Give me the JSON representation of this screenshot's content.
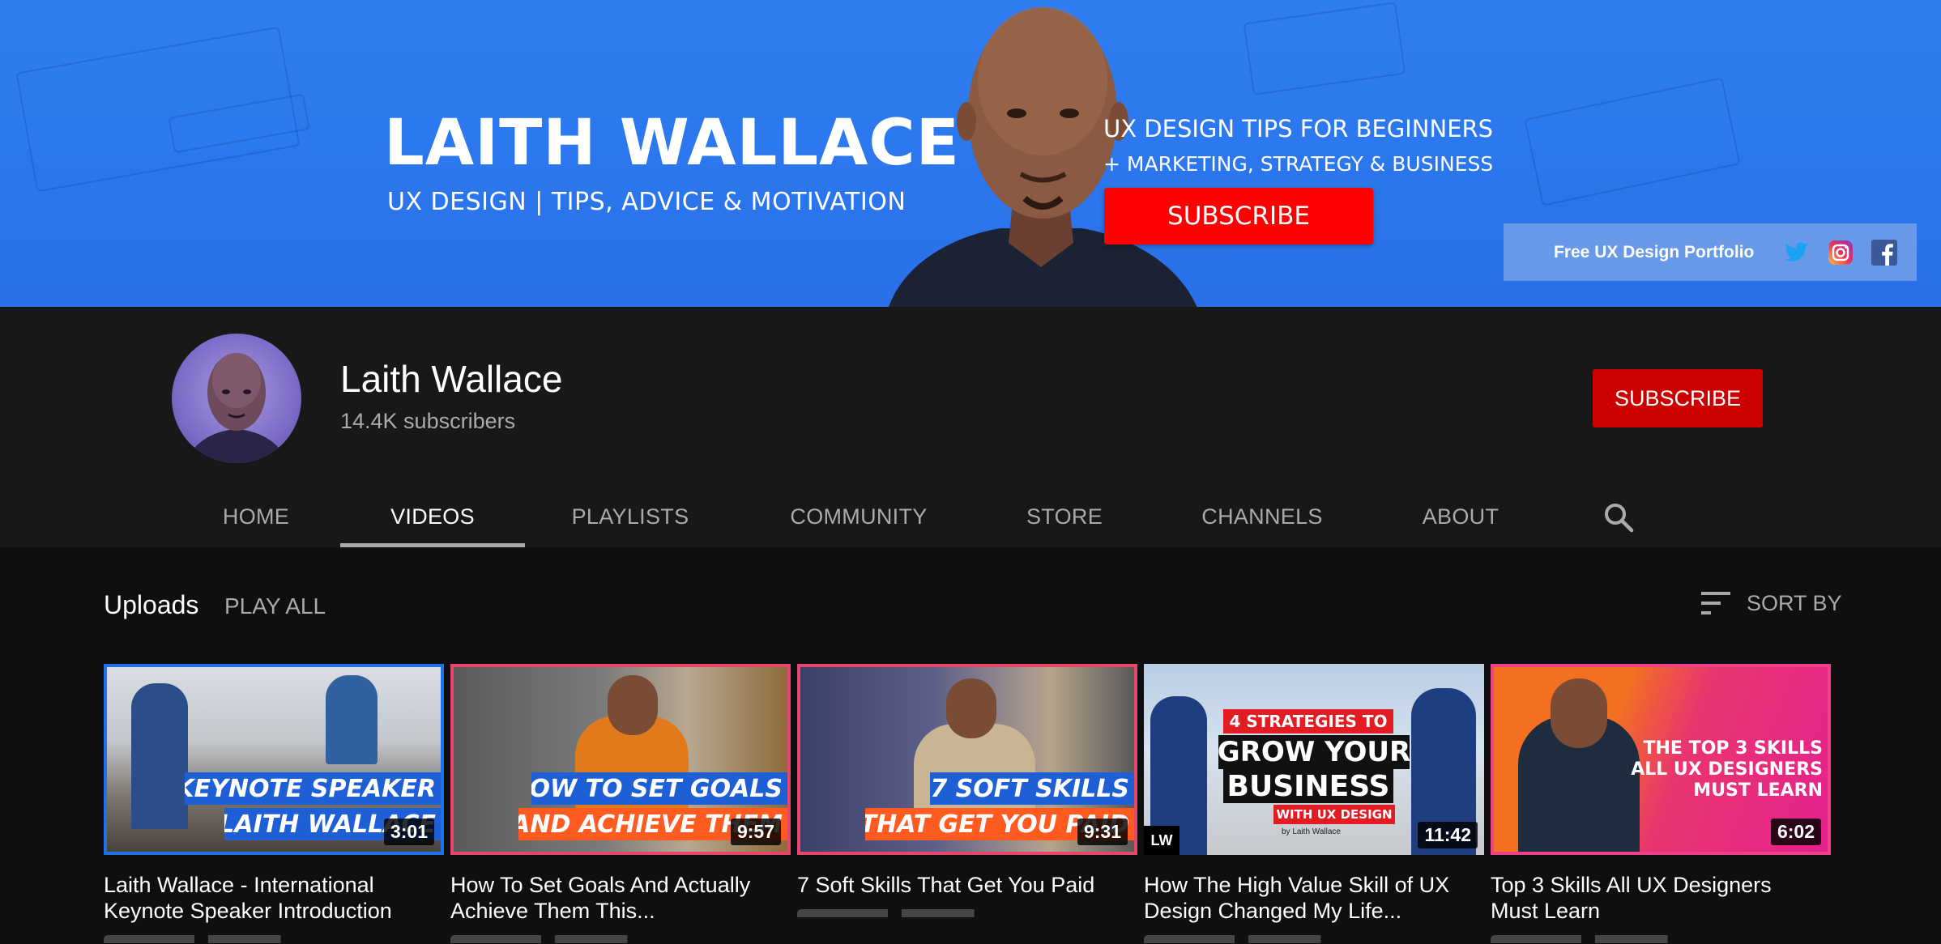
{
  "banner": {
    "title": "LAITH WALLACE",
    "subtitle": "UX DESIGN | TIPS, ADVICE & MOTIVATION",
    "tip_line1": "UX DESIGN  TIPS FOR BEGINNERS",
    "tip_line2": "+ MARKETING, STRATEGY & BUSINESS",
    "subscribe_label": "SUBSCRIBE",
    "link_text": "Free UX Design Portfolio",
    "social_icons": [
      "twitter-icon",
      "instagram-icon",
      "facebook-icon"
    ],
    "colors": {
      "background": "#2c78ee",
      "subscribe": "#ff0000"
    }
  },
  "channel": {
    "name": "Laith Wallace",
    "subscribers": "14.4K subscribers",
    "subscribe_label": "SUBSCRIBE",
    "subscribe_color": "#cc0000"
  },
  "tabs": [
    {
      "label": "HOME",
      "active": false
    },
    {
      "label": "VIDEOS",
      "active": true
    },
    {
      "label": "PLAYLISTS",
      "active": false
    },
    {
      "label": "COMMUNITY",
      "active": false
    },
    {
      "label": "STORE",
      "active": false
    },
    {
      "label": "CHANNELS",
      "active": false
    },
    {
      "label": "ABOUT",
      "active": false
    }
  ],
  "uploads": {
    "title": "Uploads",
    "play_all": "PLAY ALL",
    "sort_by": "SORT BY"
  },
  "videos": [
    {
      "title": "Laith Wallace - International Keynote Speaker Introduction",
      "duration": "3:01",
      "thumb_line1": "KEYNOTE SPEAKER",
      "thumb_line2": "LAITH WALLACE",
      "border_color": "#1e73e8"
    },
    {
      "title": "How To Set Goals And Actually Achieve Them This...",
      "duration": "9:57",
      "thumb_line1": "HOW TO SET GOALS",
      "thumb_line2": "AND ACHIEVE THEM",
      "border_color": "#e8456a"
    },
    {
      "title": "7 Soft Skills That Get You Paid",
      "duration": "9:31",
      "thumb_line1": "7 SOFT SKILLS",
      "thumb_line2": "THAT GET YOU PAID",
      "border_color": "#e8456a"
    },
    {
      "title": "How The High Value Skill of UX Design Changed My Life...",
      "duration": "11:42",
      "thumb_line1": "4 STRATEGIES TO",
      "thumb_line2": "GROW YOUR",
      "thumb_line3": "BUSINESS",
      "thumb_line4": "WITH UX DESIGN",
      "thumb_byline": "by Laith Wallace",
      "thumb_logo": "LW",
      "border_color": "#ffffff"
    },
    {
      "title": "Top 3 Skills All UX Designers Must Learn",
      "duration": "6:02",
      "thumb_line1": "THE TOP 3 SKILLS",
      "thumb_line2": "ALL UX DESIGNERS",
      "thumb_line3": "MUST LEARN",
      "border_color": "#f0408a"
    }
  ]
}
